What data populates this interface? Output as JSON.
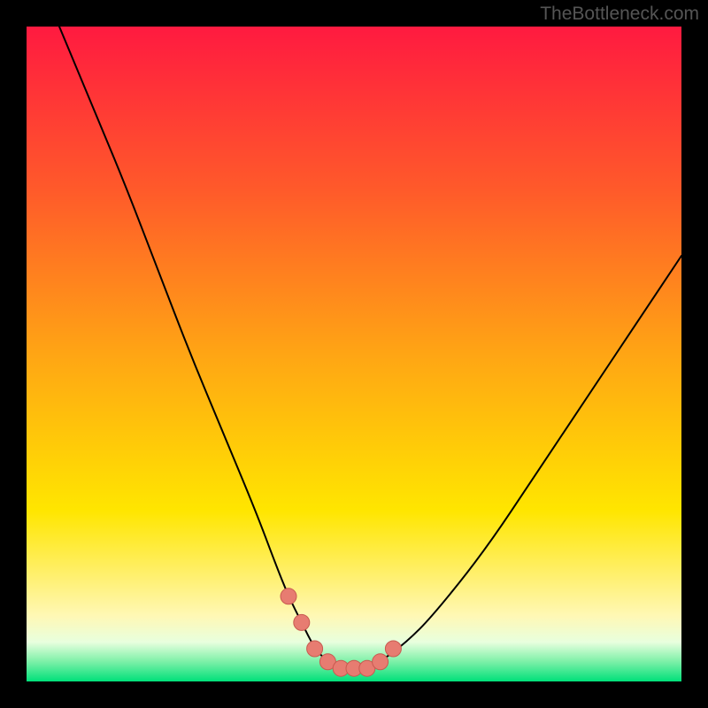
{
  "watermark": "TheBottleneck.com",
  "colors": {
    "gradient": {
      "c0": "#ff1a40",
      "c1": "#ff5a2a",
      "c2": "#ffa514",
      "c3": "#ffe600",
      "c4": "#fff070",
      "c5": "#fff8b5",
      "c6": "#e8ffde",
      "c7": "#7cf0a7",
      "c8": "#00e07a"
    },
    "curve_stroke": "#000000",
    "marker_fill": "#e77c71",
    "marker_stroke": "#c85a50"
  },
  "chart_data": {
    "type": "line",
    "title": "",
    "xlabel": "",
    "ylabel": "",
    "xlim": [
      0,
      100
    ],
    "ylim": [
      0,
      100
    ],
    "series": [
      {
        "name": "bottleneck-curve",
        "x": [
          5,
          10,
          15,
          20,
          25,
          30,
          35,
          38,
          40,
          42,
          44,
          46,
          48,
          50,
          52,
          54,
          58,
          62,
          70,
          78,
          86,
          94,
          100
        ],
        "values": [
          100,
          88,
          76,
          63,
          50,
          38,
          26,
          18,
          13,
          9,
          5,
          3,
          2,
          2,
          2,
          3,
          6,
          10,
          20,
          32,
          44,
          56,
          65
        ]
      }
    ],
    "markers": {
      "name": "highlight-points",
      "x": [
        40,
        42,
        44,
        46,
        48,
        50,
        52,
        54,
        56
      ],
      "values": [
        13,
        9,
        5,
        3,
        2,
        2,
        2,
        3,
        5
      ]
    }
  }
}
